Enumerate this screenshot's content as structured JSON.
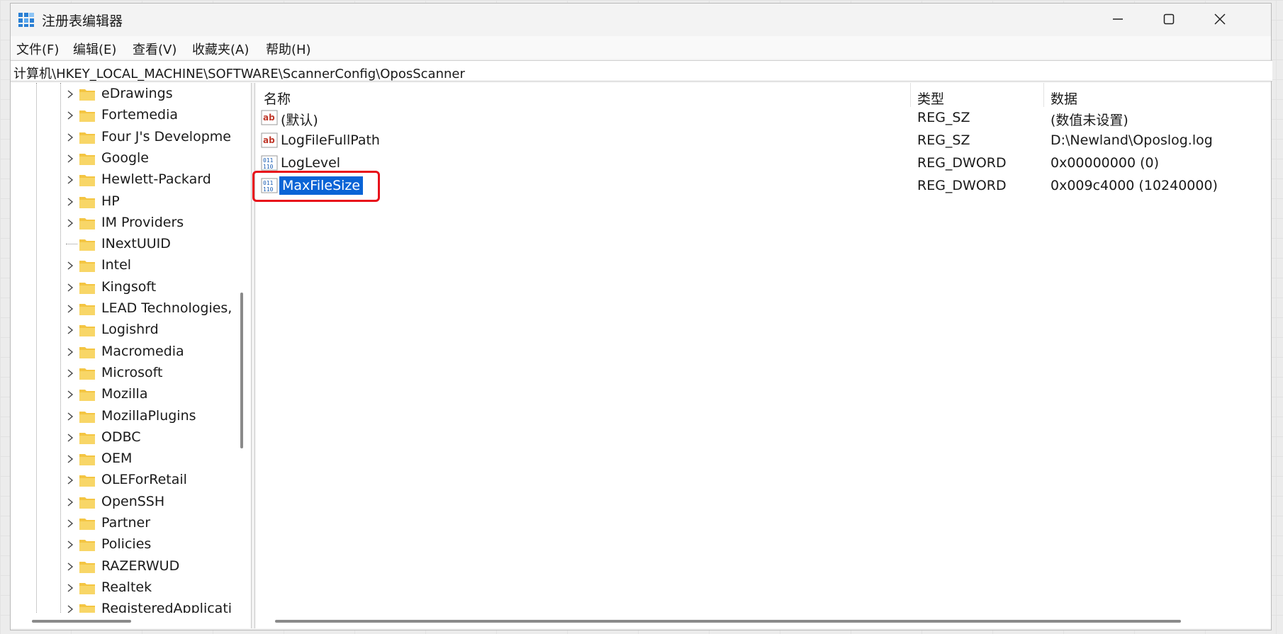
{
  "window": {
    "title": "注册表编辑器"
  },
  "menu": [
    "文件(F)",
    "编辑(E)",
    "查看(V)",
    "收藏夹(A)",
    "帮助(H)"
  ],
  "address": "计算机\\HKEY_LOCAL_MACHINE\\SOFTWARE\\ScannerConfig\\OposScanner",
  "tree": {
    "items": [
      {
        "label": "eDrawings",
        "expandable": true
      },
      {
        "label": "Fortemedia",
        "expandable": true
      },
      {
        "label": "Four J's Developme",
        "expandable": true
      },
      {
        "label": "Google",
        "expandable": true
      },
      {
        "label": "Hewlett-Packard",
        "expandable": true
      },
      {
        "label": "HP",
        "expandable": true
      },
      {
        "label": "IM Providers",
        "expandable": true
      },
      {
        "label": "INextUUID",
        "expandable": false
      },
      {
        "label": "Intel",
        "expandable": true
      },
      {
        "label": "Kingsoft",
        "expandable": true
      },
      {
        "label": "LEAD Technologies,",
        "expandable": true
      },
      {
        "label": "Logishrd",
        "expandable": true
      },
      {
        "label": "Macromedia",
        "expandable": true
      },
      {
        "label": "Microsoft",
        "expandable": true
      },
      {
        "label": "Mozilla",
        "expandable": true
      },
      {
        "label": "MozillaPlugins",
        "expandable": true
      },
      {
        "label": "ODBC",
        "expandable": true
      },
      {
        "label": "OEM",
        "expandable": true
      },
      {
        "label": "OLEForRetail",
        "expandable": true
      },
      {
        "label": "OpenSSH",
        "expandable": true
      },
      {
        "label": "Partner",
        "expandable": true
      },
      {
        "label": "Policies",
        "expandable": true
      },
      {
        "label": "RAZERWUD",
        "expandable": true
      },
      {
        "label": "Realtek",
        "expandable": true
      },
      {
        "label": "RegisteredApplicati",
        "expandable": true
      }
    ]
  },
  "list": {
    "headers": {
      "name": "名称",
      "type": "类型",
      "data": "数据"
    },
    "rows": [
      {
        "name": "(默认)",
        "type": "REG_SZ",
        "data": "(数值未设置)",
        "icon": "string-value-icon"
      },
      {
        "name": "LogFileFullPath",
        "type": "REG_SZ",
        "data": "D:\\Newland\\Oposlog.log",
        "icon": "string-value-icon"
      },
      {
        "name": "LogLevel",
        "type": "REG_DWORD",
        "data": "0x00000000 (0)",
        "icon": "binary-value-icon"
      },
      {
        "name": "MaxFileSize",
        "type": "REG_DWORD",
        "data": "0x009c4000 (10240000)",
        "icon": "binary-value-icon",
        "selected": true
      }
    ]
  },
  "colors": {
    "selection": "#0a64d6",
    "highlight_box": "#e8101a",
    "folder": "#f4c542"
  }
}
